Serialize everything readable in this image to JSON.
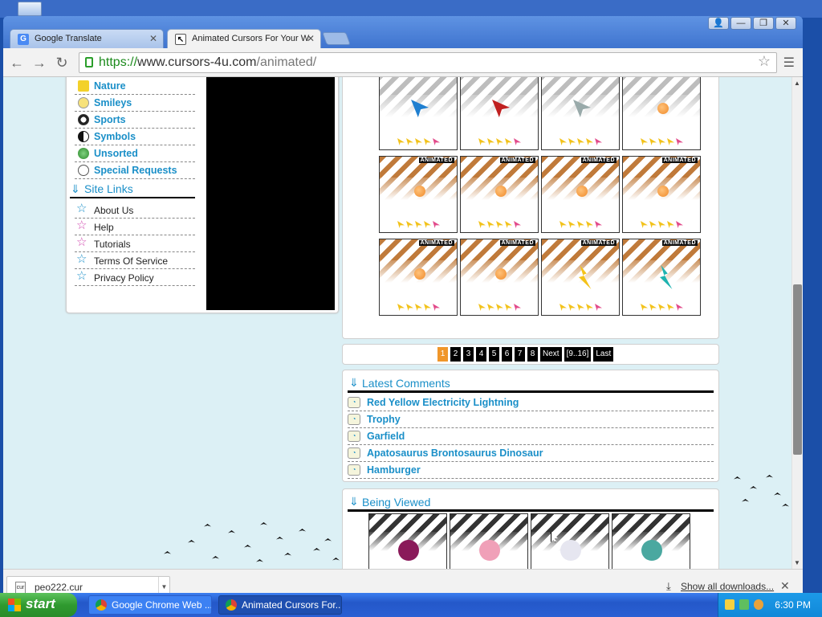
{
  "browser": {
    "tabs": [
      {
        "label": "Google Translate",
        "icon": "google-icon",
        "active": false
      },
      {
        "label": "Animated Cursors For Your W",
        "icon": "cursor-site-icon",
        "active": true
      }
    ],
    "url_scheme": "https://",
    "url_host": "www.cursors-4u.com",
    "url_path": "/animated/"
  },
  "sidebar": {
    "categories": [
      "Nature",
      "Smileys",
      "Sports",
      "Symbols",
      "Unsorted",
      "Special Requests"
    ],
    "site_links_title": "Site Links",
    "site_links": [
      "About Us",
      "Help",
      "Tutorials",
      "Terms Of Service",
      "Privacy Policy"
    ]
  },
  "grid": {
    "animated_tag": "ANIMATED",
    "rows": [
      [
        {
          "animated": false,
          "art": "blue-arrow",
          "rating": 4
        },
        {
          "animated": false,
          "art": "red-arrow",
          "rating": 4
        },
        {
          "animated": false,
          "art": "silver-arrow",
          "rating": 4
        },
        {
          "animated": false,
          "art": "dragon-ball",
          "rating": 4
        }
      ],
      [
        {
          "animated": true,
          "art": "dragon-ball",
          "rating": 4
        },
        {
          "animated": true,
          "art": "dragon-ball",
          "rating": 4
        },
        {
          "animated": true,
          "art": "dragon-ball",
          "rating": 4
        },
        {
          "animated": true,
          "art": "dragon-ball",
          "rating": 4
        }
      ],
      [
        {
          "animated": true,
          "art": "dragon-ball",
          "rating": 4
        },
        {
          "animated": true,
          "art": "dragon-ball",
          "rating": 4
        },
        {
          "animated": true,
          "art": "yellow-lightning",
          "rating": 4
        },
        {
          "animated": true,
          "art": "teal-lightning",
          "rating": 4
        }
      ]
    ]
  },
  "pager": {
    "pages": [
      "1",
      "2",
      "3",
      "4",
      "5",
      "6",
      "7",
      "8"
    ],
    "current": "1",
    "next_label": "Next",
    "range_label": "[9..16]",
    "last_label": "Last"
  },
  "latest_comments": {
    "title": "Latest Comments",
    "items": [
      "Red Yellow Electricity Lightning",
      "Trophy",
      "Garfield",
      "Apatosaurus Brontosaurus Dinosaur",
      "Hamburger"
    ]
  },
  "being_viewed": {
    "title": "Being Viewed",
    "items": [
      "monster-eye",
      "anime-girl",
      "white-mask",
      "teal-robot"
    ]
  },
  "downloads": {
    "file_name": "peo222.cur",
    "show_all_label": "Show all downloads..."
  },
  "taskbar": {
    "start_label": "start",
    "tasks": [
      "Google Chrome Web ...",
      "Animated Cursors For..."
    ],
    "clock": "6:30 PM"
  },
  "colors": {
    "link_blue": "#1a8fc8",
    "page_bg": "#dcf0f5",
    "pager_current": "#f0962a",
    "xp_blue": "#2458c9",
    "start_green": "#2f9a2f"
  }
}
